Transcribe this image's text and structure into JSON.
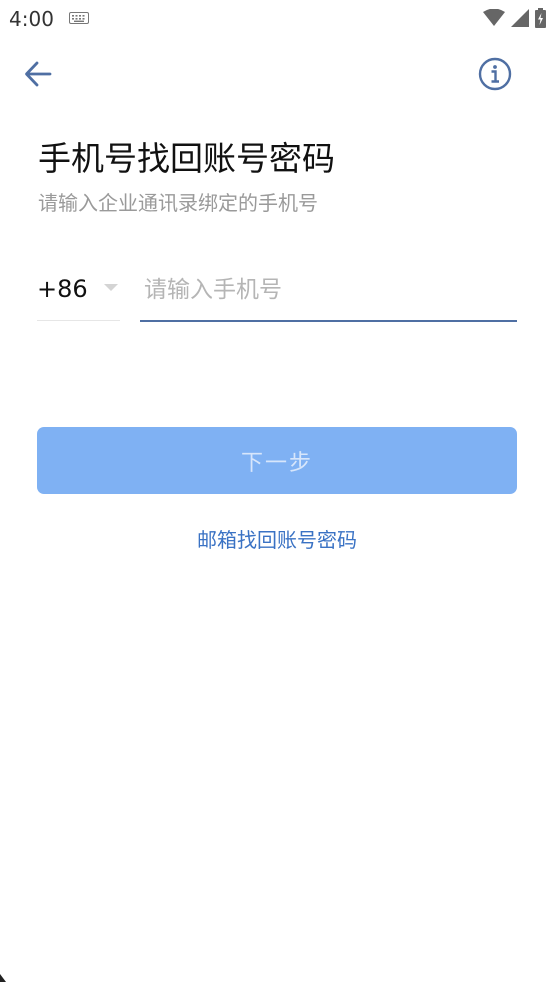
{
  "status_bar": {
    "time": "4:00",
    "icons": [
      "keyboard-icon",
      "wifi-icon",
      "cellular-signal-icon",
      "battery-charging-icon"
    ]
  },
  "app_bar": {
    "back_icon": "arrow-left-icon",
    "info_icon": "info-circle-icon"
  },
  "header": {
    "title": "手机号找回账号密码",
    "subtitle": "请输入企业通讯录绑定的手机号"
  },
  "phone_form": {
    "country_code": "+86",
    "phone_value": "",
    "phone_placeholder": "请输入手机号"
  },
  "actions": {
    "next_label": "下一步",
    "email_recovery_label": "邮箱找回账号密码"
  },
  "colors": {
    "accent": "#4f6fa3",
    "button_disabled_bg": "#7fb1f3",
    "link": "#3a72c4"
  }
}
